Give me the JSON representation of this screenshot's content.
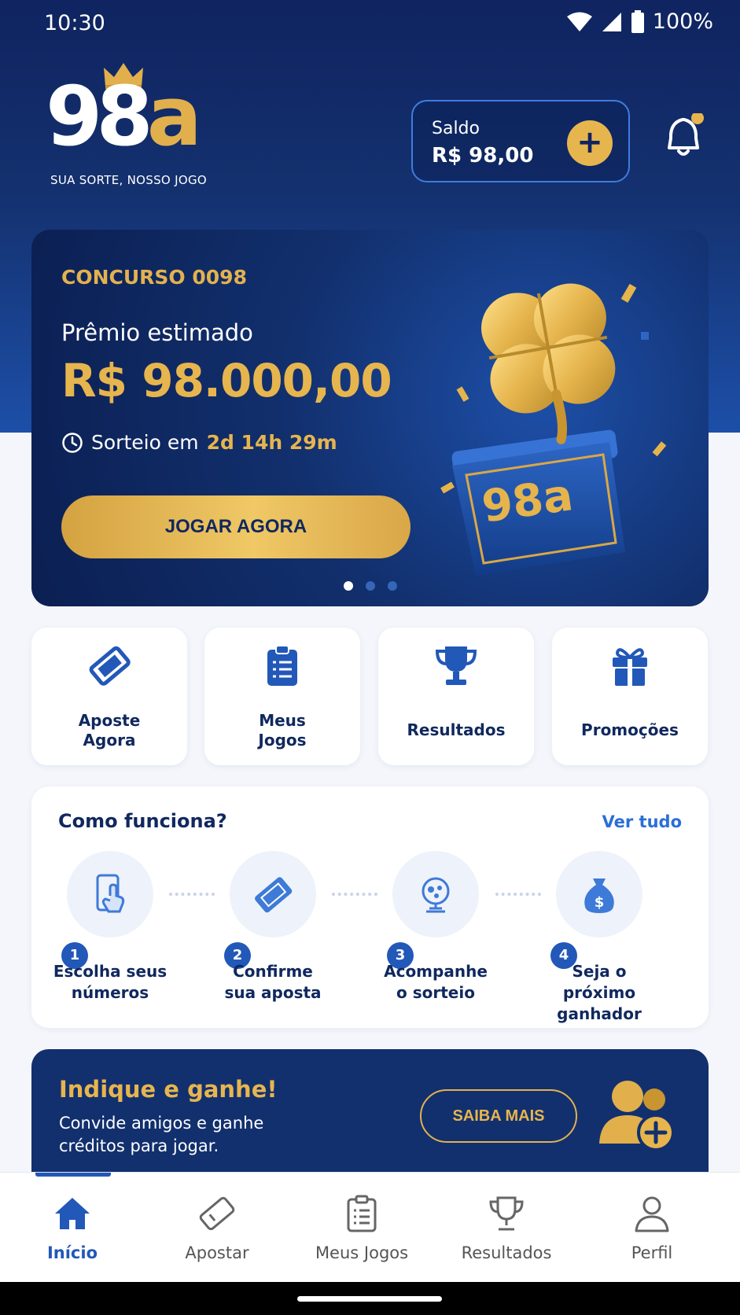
{
  "status_bar": {
    "time": "10:30",
    "battery": "100%"
  },
  "header": {
    "logo_text": "98a",
    "tagline": "SUA SORTE, NOSSO JOGO",
    "saldo_label": "Saldo",
    "saldo_value": "R$ 98,00"
  },
  "banner": {
    "concurso": "CONCURSO 0098",
    "premio_label": "Prêmio estimado",
    "premio_value": "R$ 98.000,00",
    "sorteio_prefix": "Sorteio em",
    "sorteio_time": "2d 14h 29m",
    "cta": "JOGAR AGORA",
    "pages": 3,
    "active_page": 1,
    "art_logo": "98a"
  },
  "quick_actions": [
    {
      "label": "Aposte\nAgora",
      "icon": "ticket-icon"
    },
    {
      "label": "Meus\nJogos",
      "icon": "clipboard-icon"
    },
    {
      "label": "Resultados",
      "icon": "trophy-icon"
    },
    {
      "label": "Promoções",
      "icon": "gift-icon"
    }
  ],
  "como_funciona": {
    "title": "Como funciona?",
    "ver_tudo": "Ver tudo",
    "steps": [
      {
        "n": "1",
        "label": "Escolha seus\nnúmeros",
        "icon": "phone-tap-icon"
      },
      {
        "n": "2",
        "label": "Confirme\nsua aposta",
        "icon": "ticket-icon"
      },
      {
        "n": "3",
        "label": "Acompanhe\no sorteio",
        "icon": "lottery-globe-icon"
      },
      {
        "n": "4",
        "label": "Seja o\npróximo ganhador",
        "icon": "money-bag-icon"
      }
    ]
  },
  "indique": {
    "title": "Indique e ganhe!",
    "desc": "Convide amigos e ganhe créditos para jogar.",
    "button": "SAIBA MAIS"
  },
  "bottom_nav": [
    {
      "label": "Início",
      "icon": "home-icon",
      "active": true
    },
    {
      "label": "Apostar",
      "icon": "ticket-icon",
      "active": false
    },
    {
      "label": "Meus Jogos",
      "icon": "clipboard-icon",
      "active": false
    },
    {
      "label": "Resultados",
      "icon": "trophy-icon",
      "active": false
    },
    {
      "label": "Perfil",
      "icon": "user-icon",
      "active": false
    }
  ],
  "colors": {
    "navy": "#12306e",
    "gold": "#e7b54e",
    "blue": "#2258b8"
  }
}
